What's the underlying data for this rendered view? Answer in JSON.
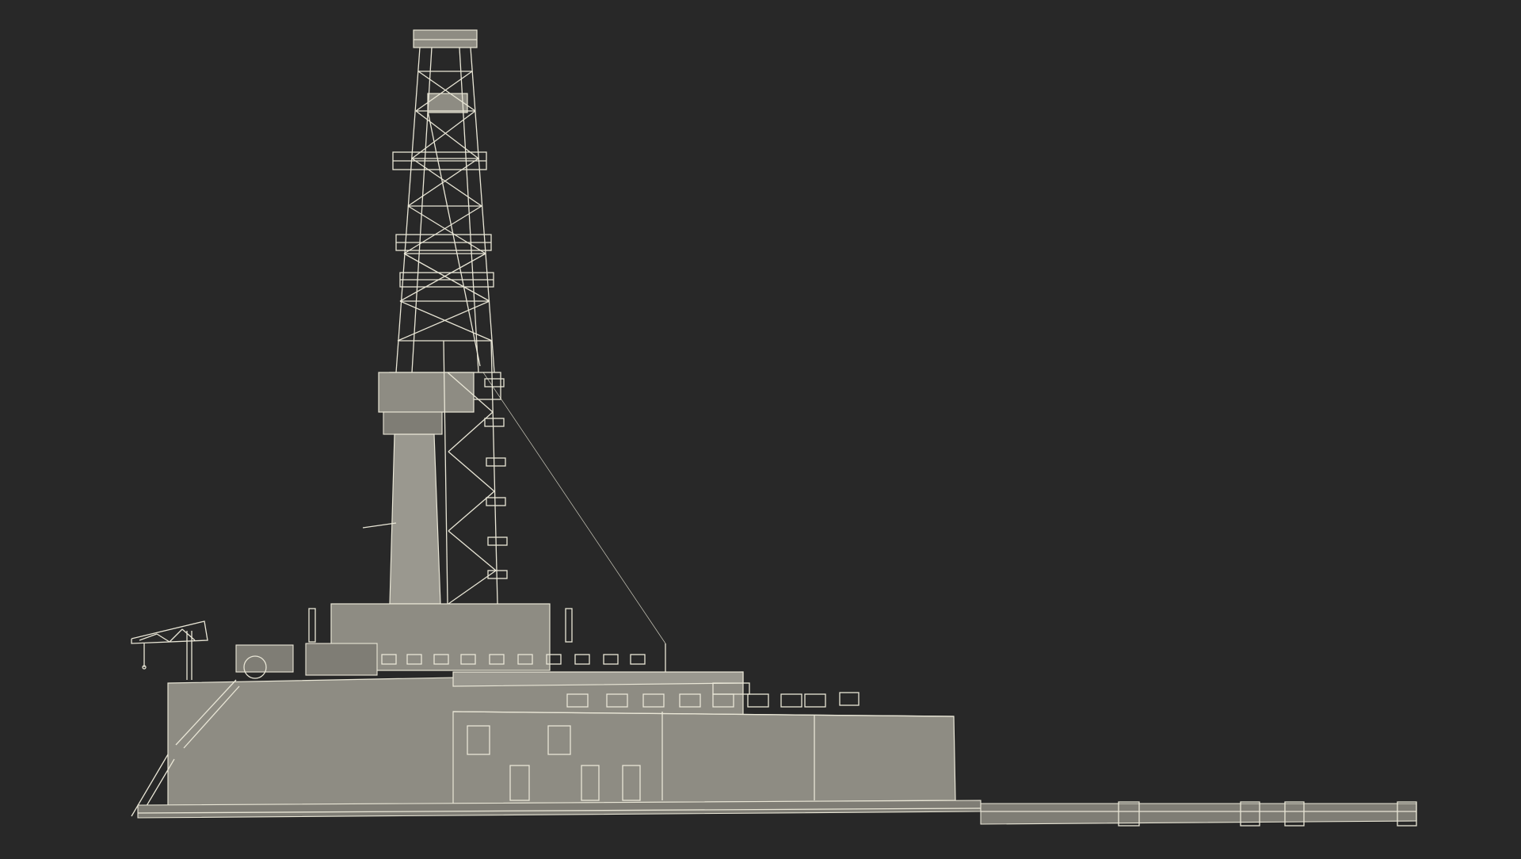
{
  "scene": {
    "background_color": "#282828",
    "wire_color": "#e9e6d6",
    "shaded_color": "#8e8c83"
  }
}
